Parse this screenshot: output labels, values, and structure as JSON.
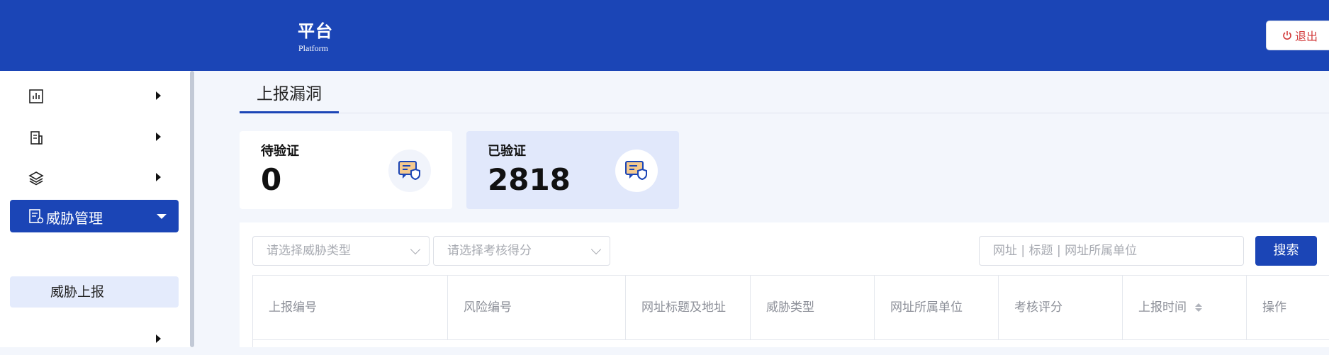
{
  "header": {
    "title": "平台",
    "subtitle": "Platform",
    "logout_label": "退出",
    "bg_color": "#1b45b6"
  },
  "sidebar": {
    "items": [
      {
        "icon": "bar-chart-icon",
        "label": ""
      },
      {
        "icon": "building-icon",
        "label": ""
      },
      {
        "icon": "layers-icon",
        "label": ""
      },
      {
        "icon": "threat-doc-icon",
        "label": "威胁管理",
        "active": true,
        "expanded": true
      },
      {
        "icon": "",
        "label": ""
      }
    ],
    "subitems": [
      {
        "label": "威胁上报",
        "selected": true
      }
    ]
  },
  "tab": {
    "label": "上报漏洞"
  },
  "cards": [
    {
      "label": "待验证",
      "value": "0",
      "icon": "verify-shield-icon"
    },
    {
      "label": "已验证",
      "value": "2818",
      "icon": "verify-shield-icon"
    }
  ],
  "filters": {
    "threat_type_placeholder": "请选择威胁类型",
    "score_placeholder": "请选择考核得分",
    "search_placeholder": "网址  |  标题  |  网址所属单位",
    "search_button": "搜索"
  },
  "table": {
    "columns": [
      "上报编号",
      "风险编号",
      "网址标题及地址",
      "威胁类型",
      "网址所属单位",
      "考核评分",
      "上报时间",
      "操作"
    ]
  }
}
